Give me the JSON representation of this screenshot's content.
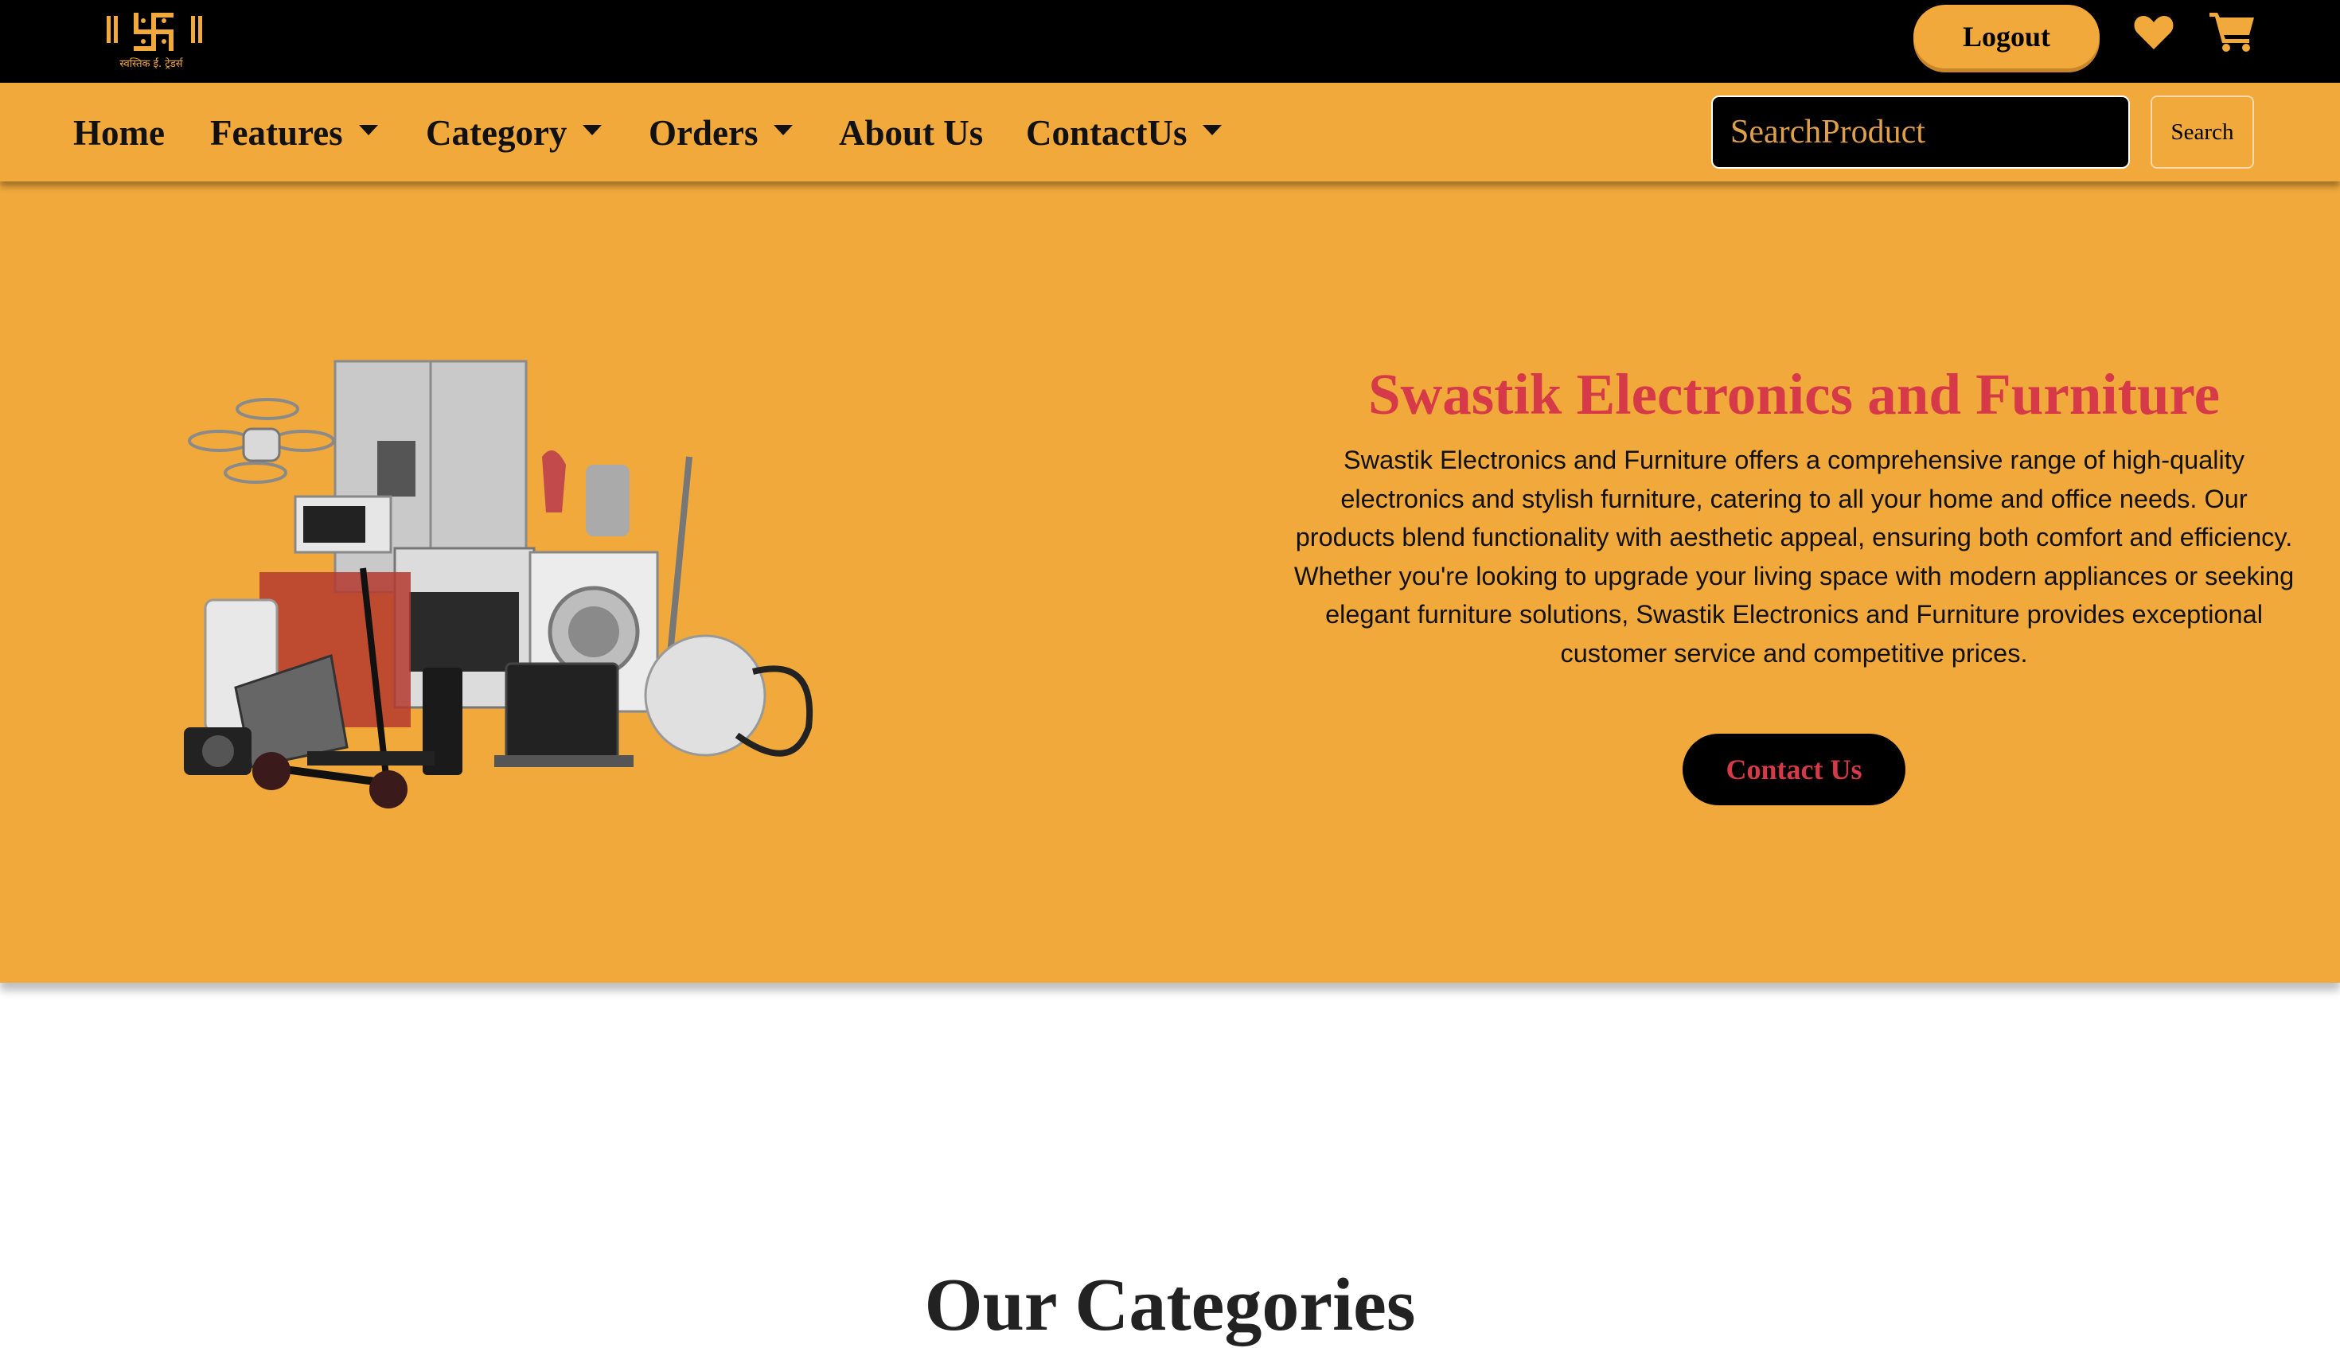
{
  "topbar": {
    "logo_caption": "स्वस्तिक ई. ट्रेडर्स",
    "logout_label": "Logout",
    "icons": {
      "wishlist": "heart-icon",
      "cart": "cart-icon"
    },
    "accent_color": "#f0a93a"
  },
  "navbar": {
    "items": [
      {
        "label": "Home",
        "dropdown": false
      },
      {
        "label": "Features",
        "dropdown": true
      },
      {
        "label": "Category",
        "dropdown": true
      },
      {
        "label": "Orders",
        "dropdown": true
      },
      {
        "label": "About Us",
        "dropdown": false
      },
      {
        "label": "ContactUs",
        "dropdown": true
      }
    ],
    "search_placeholder": "SearchProduct",
    "search_button_label": "Search"
  },
  "hero": {
    "title": "Swastik Electronics and Furniture",
    "description": "Swastik Electronics and Furniture offers a comprehensive range of high-quality electronics and stylish furniture, catering to all your home and office needs. Our products blend functionality with aesthetic appeal, ensuring both comfort and efficiency. Whether you're looking to upgrade your living space with modern appliances or seeking elegant furniture solutions, Swastik Electronics and Furniture provides exceptional customer service and competitive prices.",
    "cta_label": "Contact Us",
    "title_color": "#d63a48",
    "background_color": "#f0a93a"
  },
  "categories": {
    "heading": "Our Categories"
  }
}
